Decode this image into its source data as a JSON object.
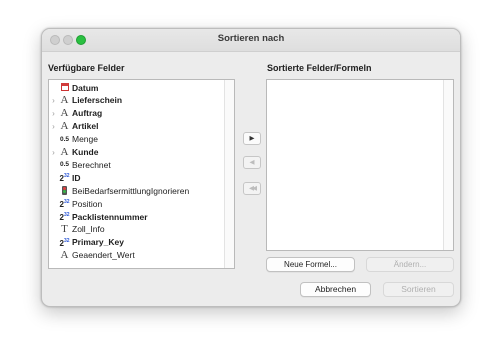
{
  "window": {
    "title": "Sortieren nach"
  },
  "available": {
    "label": "Verfügbare Felder",
    "fields": [
      {
        "name": "Datum",
        "icon": "calendar-icon",
        "bold": true,
        "expandable": false
      },
      {
        "name": "Lieferschein",
        "icon": "text-field-icon",
        "bold": true,
        "expandable": true
      },
      {
        "name": "Auftrag",
        "icon": "text-field-icon",
        "bold": true,
        "expandable": true
      },
      {
        "name": "Artikel",
        "icon": "text-field-icon",
        "bold": true,
        "expandable": true
      },
      {
        "name": "Menge",
        "icon": "decimal-icon",
        "bold": false,
        "expandable": false
      },
      {
        "name": "Kunde",
        "icon": "text-field-icon",
        "bold": true,
        "expandable": true
      },
      {
        "name": "Berechnet",
        "icon": "decimal-icon",
        "bold": false,
        "expandable": false
      },
      {
        "name": "ID",
        "icon": "integer-icon",
        "bold": true,
        "expandable": false
      },
      {
        "name": "BeiBedarfsermittlungIgnorieren",
        "icon": "boolean-icon",
        "bold": false,
        "expandable": false
      },
      {
        "name": "Position",
        "icon": "integer-icon",
        "bold": false,
        "expandable": false
      },
      {
        "name": "Packlistennummer",
        "icon": "integer-icon",
        "bold": true,
        "expandable": false
      },
      {
        "name": "Zoll_Info",
        "icon": "text-icon",
        "bold": false,
        "expandable": false
      },
      {
        "name": "Primary_Key",
        "icon": "integer-icon",
        "bold": true,
        "expandable": false
      },
      {
        "name": "Geaendert_Wert",
        "icon": "text-field-icon",
        "bold": false,
        "expandable": false
      }
    ]
  },
  "icon_glyphs": {
    "text-field-icon": "A",
    "decimal-icon": "0.5",
    "integer-icon": "2",
    "integer-exp": "32",
    "text-icon": "T",
    "chevron": "›"
  },
  "transfer": {
    "add_glyph": "▶",
    "remove_glyph": "◀",
    "remove_all_glyph": "◀◀"
  },
  "sorted": {
    "label": "Sortierte Felder/Formeln"
  },
  "buttons": {
    "new_formula": "Neue Formel...",
    "change": "Ändern...",
    "cancel": "Abbrechen",
    "sort": "Sortieren"
  },
  "colors": {
    "close_gray": "#cfcfcf",
    "zoom_green": "#2ac041",
    "integer_exp_blue": "#2b57d8"
  }
}
